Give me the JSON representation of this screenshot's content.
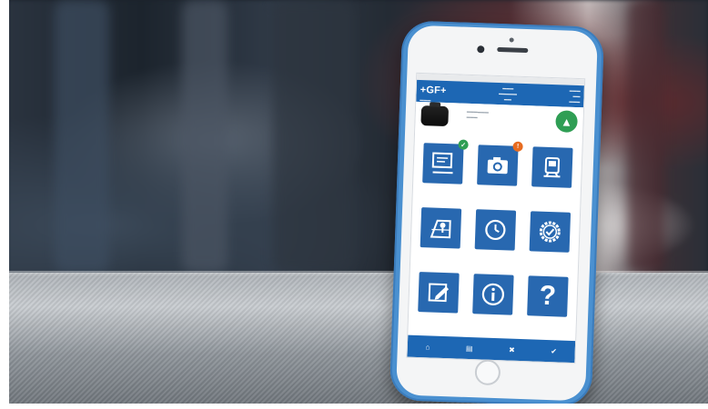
{
  "app": {
    "logo": "+GF+",
    "status_left": "",
    "status_right": ""
  },
  "colors": {
    "primary": "#1d67b4",
    "tile": "#2868b0",
    "success": "#2f9e54",
    "alert": "#e76b1f",
    "case": "#4a90d0"
  },
  "badges": {
    "message_count": "✓",
    "photo_count": "!"
  },
  "tiles": [
    {
      "icon": "message-board-icon",
      "caption": ""
    },
    {
      "icon": "camera-icon",
      "caption": ""
    },
    {
      "icon": "machine-icon",
      "caption": ""
    },
    {
      "icon": "location-map-icon",
      "caption": ""
    },
    {
      "icon": "clock-icon",
      "caption": ""
    },
    {
      "icon": "checkmark-gear-icon",
      "caption": ""
    },
    {
      "icon": "edit-note-icon",
      "caption": ""
    },
    {
      "icon": "info-icon",
      "caption": ""
    },
    {
      "icon": "help-question-icon",
      "caption": "",
      "glyph": "?"
    }
  ],
  "tabbar": [
    {
      "icon": "home-icon",
      "label": ""
    },
    {
      "icon": "list-icon",
      "label": ""
    },
    {
      "icon": "tools-icon",
      "label": ""
    },
    {
      "icon": "settings-icon",
      "label": ""
    }
  ]
}
